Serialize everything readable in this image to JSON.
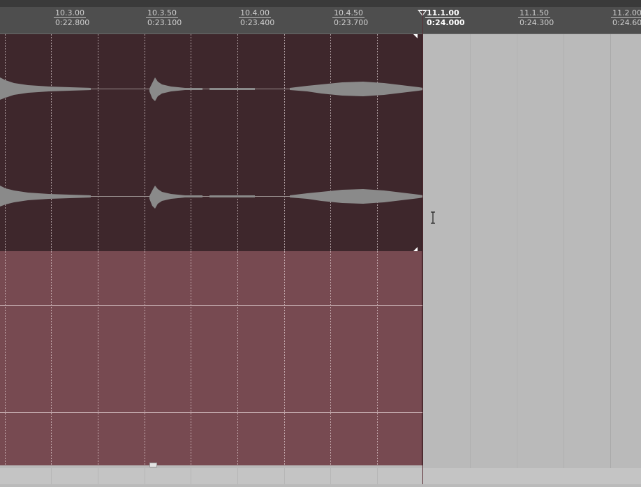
{
  "ruler": {
    "markers": [
      {
        "bar": "10.3.00",
        "time": "0:22.800",
        "current": false
      },
      {
        "bar": "10.3.50",
        "time": "0:23.100",
        "current": false
      },
      {
        "bar": "10.4.00",
        "time": "0:23.400",
        "current": false
      },
      {
        "bar": "10.4.50",
        "time": "0:23.700",
        "current": false
      },
      {
        "bar": "11.1.00",
        "time": "0:24.000",
        "current": true
      },
      {
        "bar": "11.1.50",
        "time": "0:24.300",
        "current": false
      },
      {
        "bar": "11.2.00",
        "time": "0:24.600",
        "current": false
      }
    ]
  },
  "colors": {
    "audio_clip": "#3e272c",
    "midi_clip": "#774a51",
    "waveform": "#8a8a8a",
    "empty_lane": "#bababa",
    "ruler": "#4e4e4e"
  },
  "icons": {
    "playhead": "playhead-flag-icon",
    "cursor": "text-cursor-icon",
    "handle": "clip-resize-handle-icon"
  }
}
